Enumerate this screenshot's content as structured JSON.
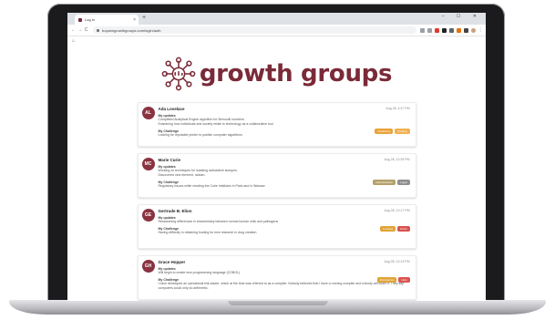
{
  "browser": {
    "tab_title": "Log in",
    "tab_close": "×",
    "new_tab": "+",
    "window_controls": "– ☐ ✕",
    "url": "boyanngrowthgroups.com/login/auth",
    "back": "←",
    "forward": "→",
    "reload": "C",
    "home": "⌂"
  },
  "brand": {
    "name": "growth groups",
    "color": "#7a2a38"
  },
  "cards": [
    {
      "initials": "AL",
      "name": "Ada Lovelace",
      "date": "Aug 28, 4:47 PM",
      "updates_label": "My updates",
      "updates": [
        "Completed Analytical Engine algorithm for Bernoulli numbers.",
        "Examining how individuals and society relate to technology as a collaborative tool."
      ],
      "challenge_label": "My Challenge",
      "challenge": "Looking for reputable printer to publish computer algorithms",
      "badges": [
        {
          "text": "Publishing",
          "color": "#e8a23a"
        },
        {
          "text": "Printing",
          "color": "#f0b050"
        }
      ]
    },
    {
      "initials": "MC",
      "name": "Marie Curie",
      "date": "Aug 28, 12:39 PM",
      "updates_label": "My updates",
      "updates": [
        "Working on techniques for isolating radioactive isotopes.",
        "Discovered new element, radium."
      ],
      "challenge_label": "My Challenge",
      "challenge": "Regulatory issues while creating the Curie Institutes in Paris and in Warsaw",
      "badges": [
        {
          "text": "Administration",
          "color": "#b5a06a"
        },
        {
          "text": "Legal",
          "color": "#8f8f8f"
        }
      ]
    },
    {
      "initials": "GE",
      "name": "Gertrude B. Elion",
      "date": "Aug 28, 12:17 PM",
      "updates_label": "My updates",
      "updates": [
        "Researching differences in biochemistry between normal human cells and pathogens"
      ],
      "challenge_label": "My Challenge",
      "challenge": "Having difficulty in obtaining funding for new research in drug creation",
      "badges": [
        {
          "text": "Funding",
          "color": "#e0a437"
        },
        {
          "text": "Grant",
          "color": "#d9534f"
        }
      ]
    },
    {
      "initials": "GH",
      "name": "Grace Hopper",
      "date": "Aug 28, 12:13 PM",
      "updates_label": "My updates",
      "updates": [
        "Will begin to create new programming language (COBOL)."
      ],
      "challenge_label": "My Challenge",
      "challenge": "I have developed an operational link-loader, which at the time was referred to as a compiler. Nobody believed that I have a running compiler and nobody will touch it. They say computers could only do arithmetic.",
      "badges": [
        {
          "text": "Persistence",
          "color": "#e0a437"
        },
        {
          "text": "Help",
          "color": "#d9534f"
        }
      ]
    }
  ]
}
